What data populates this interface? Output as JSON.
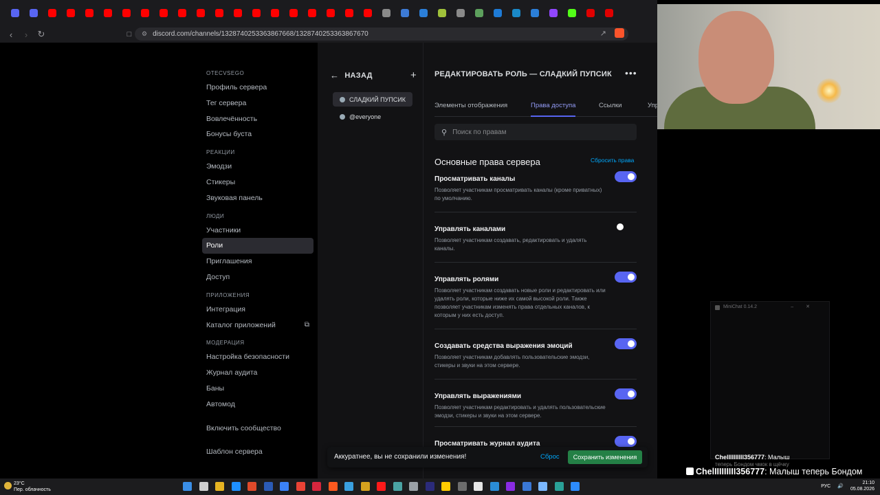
{
  "browser": {
    "url": "discord.com/channels/1328740253363867668/1328740253363867670",
    "tab_colors": [
      "#5865f2",
      "#5865f2",
      "#ff0000",
      "#ff0000",
      "#ff0000",
      "#ff0000",
      "#ff0000",
      "#ff0000",
      "#ff0000",
      "#ff0000",
      "#ff0000",
      "#ff0000",
      "#ff0000",
      "#ff0000",
      "#ff0000",
      "#ff0000",
      "#ff0000",
      "#ff0000",
      "#ff0000",
      "#ff0000",
      "#8a8a8a",
      "#3d7bd6",
      "#2b7fd9",
      "#9fc13a",
      "#8a8a8a",
      "#5da05d",
      "#1e7bd6",
      "#1a89c8",
      "#2b7fd9",
      "#9146ff",
      "#53fc18",
      "#e00000",
      "#e00000"
    ]
  },
  "settings_nav": {
    "categories": [
      {
        "label": "OTECVSEGO",
        "items": [
          {
            "label": "Профиль сервера",
            "name": "nav-server-profile"
          },
          {
            "label": "Тег сервера",
            "name": "nav-server-tag"
          },
          {
            "label": "Вовлечённость",
            "name": "nav-engagement"
          },
          {
            "label": "Бонусы буста",
            "name": "nav-boost-perks"
          }
        ]
      },
      {
        "label": "РЕАКЦИИ",
        "items": [
          {
            "label": "Эмодзи",
            "name": "nav-emoji"
          },
          {
            "label": "Стикеры",
            "name": "nav-stickers"
          },
          {
            "label": "Звуковая панель",
            "name": "nav-soundboard"
          }
        ]
      },
      {
        "label": "ЛЮДИ",
        "items": [
          {
            "label": "Участники",
            "name": "nav-members"
          },
          {
            "label": "Роли",
            "name": "nav-roles",
            "active": true
          },
          {
            "label": "Приглашения",
            "name": "nav-invites"
          },
          {
            "label": "Доступ",
            "name": "nav-access"
          }
        ]
      },
      {
        "label": "ПРИЛОЖЕНИЯ",
        "items": [
          {
            "label": "Интеграция",
            "name": "nav-integrations"
          },
          {
            "label": "Каталог приложений",
            "name": "nav-app-directory",
            "external": true
          }
        ]
      },
      {
        "label": "МОДЕРАЦИЯ",
        "items": [
          {
            "label": "Настройка безопасности",
            "name": "nav-safety-setup"
          },
          {
            "label": "Журнал аудита",
            "name": "nav-audit-log"
          },
          {
            "label": "Баны",
            "name": "nav-bans"
          },
          {
            "label": "Автомод",
            "name": "nav-automod"
          }
        ]
      }
    ],
    "extra_items": [
      {
        "label": "Включить сообщество",
        "name": "nav-enable-community"
      },
      {
        "label": "Шаблон сервера",
        "name": "nav-server-template"
      }
    ]
  },
  "roles_panel": {
    "back_label": "НАЗАД",
    "roles": [
      {
        "label": "СЛАДКИЙ ПУПСИК",
        "selected": true
      },
      {
        "label": "@everyone",
        "selected": false
      }
    ]
  },
  "editor": {
    "title": "РЕДАКТИРОВАТЬ РОЛЬ — СЛАДКИЙ ПУПСИК",
    "tabs": [
      {
        "label": "Элементы отображения",
        "active": false
      },
      {
        "label": "Права доступа",
        "active": true
      },
      {
        "label": "Ссылки",
        "active": false
      },
      {
        "label": "Упр",
        "active": false
      }
    ],
    "search_placeholder": "Поиск по правам",
    "section_title": "Основные права сервера",
    "reset_label": "Сбросить права",
    "permissions": [
      {
        "name": "Просматривать каналы",
        "desc": "Позволяет участникам просматривать каналы (кроме приватных) по умолчанию.",
        "enabled": true
      },
      {
        "name": "Управлять каналами",
        "desc": "Позволяет участникам создавать, редактировать и удалять каналы.",
        "enabled": false
      },
      {
        "name": "Управлять ролями",
        "desc": "Позволяет участникам создавать новые роли и редактировать или удалять роли, которые ниже их самой высокой роли. Также позволяет участникам изменять права отдельных каналов, к которым у них есть доступ.",
        "enabled": true
      },
      {
        "name": "Создавать средства выражения эмоций",
        "desc": "Позволяет участникам добавлять пользовательские эмодзи, стикеры и звуки на этом сервере.",
        "enabled": true
      },
      {
        "name": "Управлять выражениями",
        "desc": "Позволяет участникам редактировать и удалять пользовательские эмодзи, стикеры и звуки на этом сервере.",
        "enabled": true
      },
      {
        "name": "Просматривать журнал аудита",
        "desc": "",
        "enabled": true
      }
    ]
  },
  "unsaved_bar": {
    "message": "Аккуратнее, вы не сохранили изменения!",
    "reset_label": "Сброс",
    "save_label": "Сохранить изменения"
  },
  "stream": {
    "minichat_title": "MiniChat 0.14.2",
    "chat_small_user": "ChelIIIIIIIII356777",
    "chat_small_text": ": Малыш",
    "chat_small_ghost": "теперь Бондом чмок в щёчку",
    "chat_big_user": "ChelIIIIIIIII356777",
    "chat_big_text": ": Малыш теперь Бондом чмок в щёчку"
  },
  "taskbar": {
    "temperature": "23°C",
    "weather_text": "Пер. облачность",
    "lang": "РУС",
    "time": "21:10",
    "date": "05.08.2026",
    "app_colors": [
      "#3a8ee6",
      "#cfcfcf",
      "#e6b422",
      "#1e90ff",
      "#e04a2a",
      "#2b5bb5",
      "#3b82f6",
      "#ea4335",
      "#d7263d",
      "#ff5a1f",
      "#3aa0e0",
      "#d6a21e",
      "#ff1a1a",
      "#4aa3a3",
      "#9aa0a6",
      "#2b2b7a",
      "#ffcc00",
      "#6d6d6d",
      "#e6e6e6",
      "#2a8cd6",
      "#8a2be2",
      "#3a78d6",
      "#7ab7ff",
      "#2aa198",
      "#2d8cff"
    ]
  }
}
